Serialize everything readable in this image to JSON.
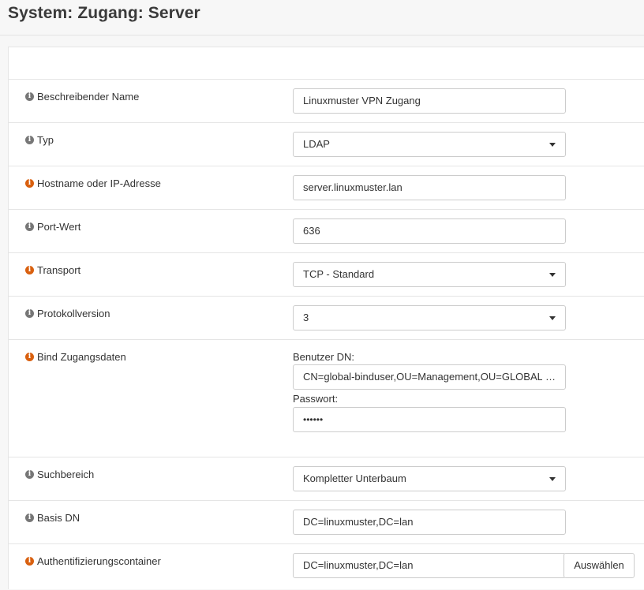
{
  "page": {
    "title": "System: Zugang: Server"
  },
  "rows": {
    "name": {
      "label": "Beschreibender Name",
      "value": "Linuxmuster VPN Zugang"
    },
    "typ": {
      "label": "Typ",
      "value": "LDAP"
    },
    "host": {
      "label": "Hostname oder IP-Adresse",
      "value": "server.linuxmuster.lan"
    },
    "port": {
      "label": "Port-Wert",
      "value": "636"
    },
    "transport": {
      "label": "Transport",
      "value": "TCP - Standard"
    },
    "protocol": {
      "label": "Protokollversion",
      "value": "3"
    },
    "bind": {
      "label": "Bind Zugangsdaten",
      "user_label": "Benutzer DN:",
      "user_value": "CN=global-binduser,OU=Management,OU=GLOBAL,",
      "user_ellipsis": "…",
      "password_label": "Passwort:",
      "password_value": "••••••"
    },
    "scope": {
      "label": "Suchbereich",
      "value": "Kompletter Unterbaum"
    },
    "base_dn": {
      "label": "Basis DN",
      "value": "DC=linuxmuster,DC=lan"
    },
    "auth_container": {
      "label": "Authentifizierungscontainer",
      "value": "DC=linuxmuster,DC=lan",
      "button": "Auswählen"
    }
  },
  "icons": {
    "info_glyph": "i"
  },
  "colors": {
    "info_gray": "#777777",
    "info_orange": "#d9600f"
  }
}
